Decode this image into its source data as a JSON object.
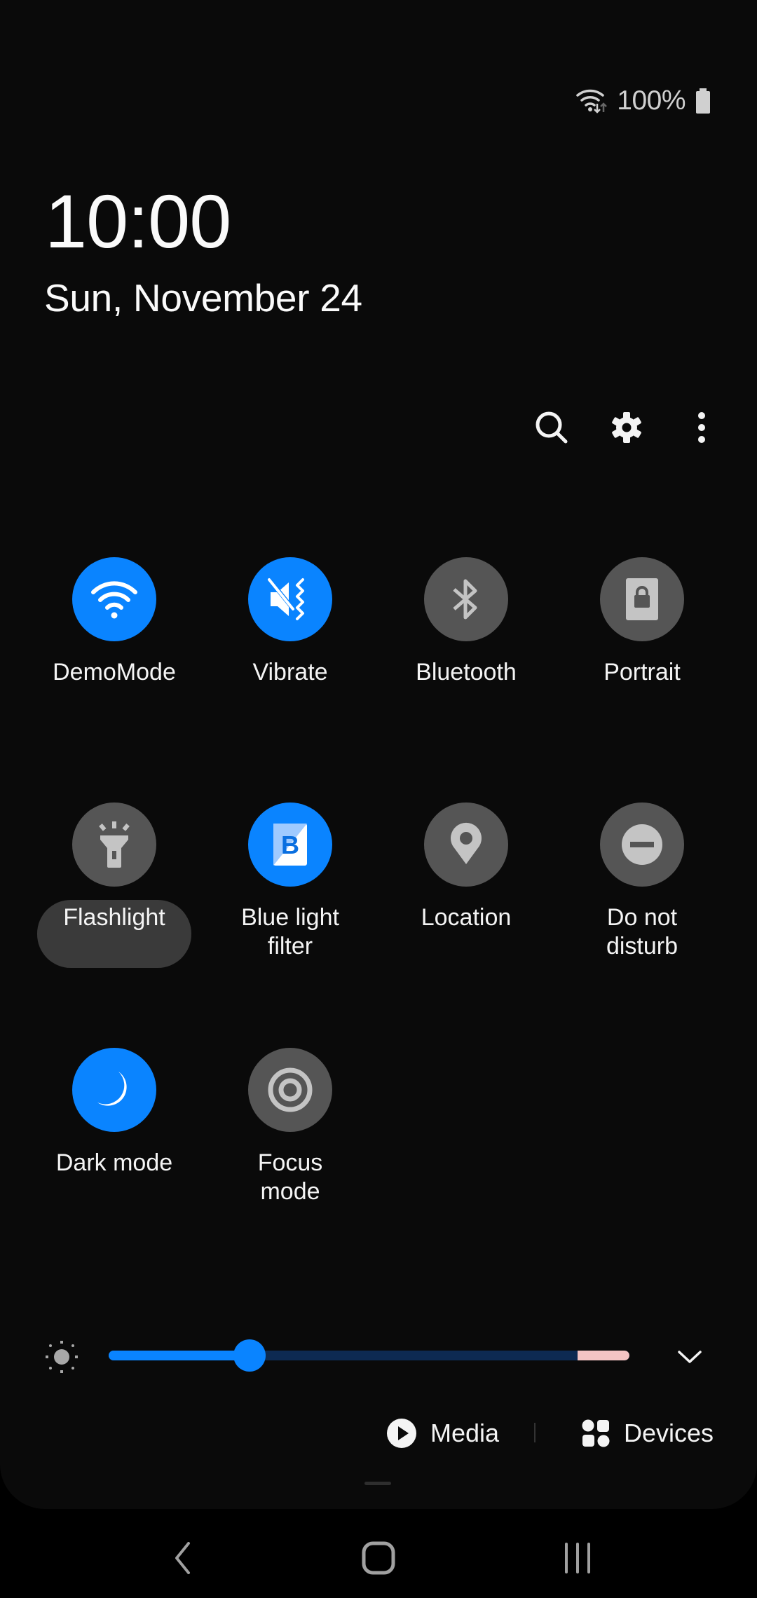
{
  "status_bar": {
    "wifi_icon": "wifi-data-activity-icon",
    "battery_percent": "100%",
    "battery_icon": "battery-full-icon"
  },
  "clock": {
    "time": "10:00",
    "date": "Sun, November 24"
  },
  "header_actions": [
    {
      "name": "search",
      "icon": "search-icon"
    },
    {
      "name": "settings",
      "icon": "gear-icon"
    },
    {
      "name": "more-options",
      "icon": "more-vertical-icon"
    }
  ],
  "tiles": [
    {
      "label": "DemoMode",
      "icon": "wifi-icon",
      "state": "on"
    },
    {
      "label": "Vibrate",
      "icon": "vibrate-icon",
      "state": "on"
    },
    {
      "label": "Bluetooth",
      "icon": "bluetooth-icon",
      "state": "off"
    },
    {
      "label": "Portrait",
      "icon": "portrait-lock-icon",
      "state": "off"
    },
    {
      "label": "Flashlight",
      "icon": "flashlight-icon",
      "state": "off",
      "highlighted": true
    },
    {
      "label": "Blue light\nfilter",
      "icon": "blue-light-filter-icon",
      "state": "on"
    },
    {
      "label": "Location",
      "icon": "location-pin-icon",
      "state": "off"
    },
    {
      "label": "Do not\ndisturb",
      "icon": "do-not-disturb-icon",
      "state": "off"
    },
    {
      "label": "Dark mode",
      "icon": "moon-icon",
      "state": "on"
    },
    {
      "label": "Focus\nmode",
      "icon": "focus-target-icon",
      "state": "off"
    }
  ],
  "brightness": {
    "value_percent": 27,
    "high_zone_start_percent": 90,
    "icon": "sun-icon",
    "expand_icon": "chevron-down-icon"
  },
  "media_row": {
    "media_label": "Media",
    "devices_label": "Devices"
  },
  "navigation": [
    {
      "name": "back",
      "icon": "back-icon"
    },
    {
      "name": "home",
      "icon": "home-icon"
    },
    {
      "name": "recents",
      "icon": "recents-icon"
    }
  ],
  "colors": {
    "accent": "#0a84ff",
    "tile_off": "#555555",
    "panel_bg": "#0a0a0a",
    "brightness_high_zone": "#f4c4c4"
  }
}
